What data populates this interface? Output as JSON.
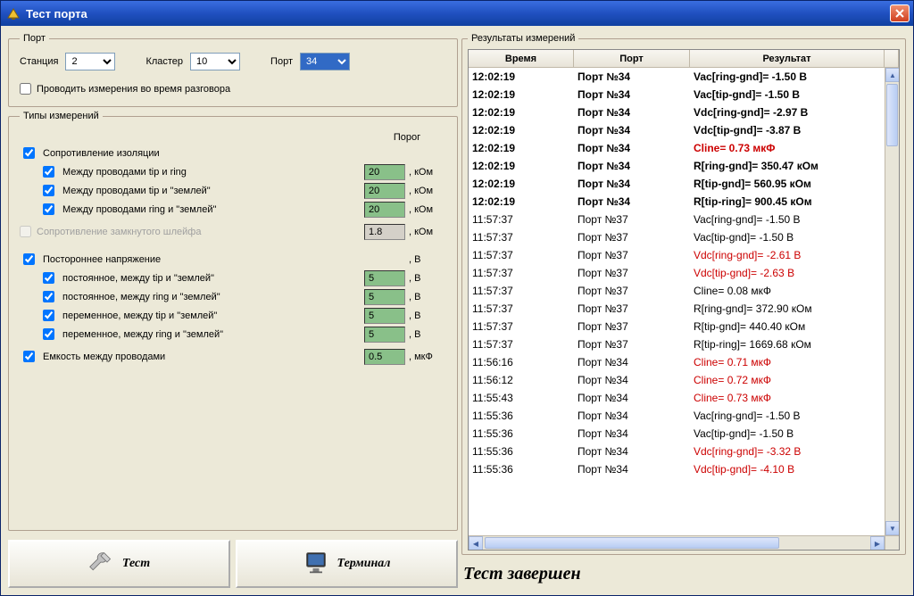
{
  "window": {
    "title": "Тест порта"
  },
  "port": {
    "legend": "Порт",
    "station_label": "Станция",
    "station_value": "2",
    "cluster_label": "Кластер",
    "cluster_value": "10",
    "port_label": "Порт",
    "port_value": "34",
    "measure_during_call": "Проводить измерения во время разговора"
  },
  "types": {
    "legend": "Типы измерений",
    "threshold_header": "Порог",
    "insulation": "Сопротивление изоляции",
    "tip_ring": "Между проводами tip и ring",
    "tip_gnd": "Между проводами tip и \"землей\"",
    "ring_gnd": "Между проводами ring и \"землей\"",
    "loop_res": "Сопротивление замкнутого шлейфа",
    "foreign_volt": "Постороннее напряжение",
    "dc_tip_gnd": "постоянное, между tip и \"землей\"",
    "dc_ring_gnd": "постоянное, между ring и \"землей\"",
    "ac_tip_gnd": "переменное, между tip и \"землей\"",
    "ac_ring_gnd": "переменное, между ring и \"землей\"",
    "capacitance": "Емкость между проводами",
    "v_tip_ring": "20",
    "v_tip_gnd": "20",
    "v_ring_gnd": "20",
    "v_loop": "1.8",
    "v_dc_tip": "5",
    "v_dc_ring": "5",
    "v_ac_tip": "5",
    "v_ac_ring": "5",
    "v_cap": "0.5",
    "u_kohm": ", кОм",
    "u_volt": ", В",
    "u_mkf": ", мкФ"
  },
  "buttons": {
    "test": "Тест",
    "terminal": "Терминал"
  },
  "results": {
    "legend": "Результаты измерений",
    "col_time": "Время",
    "col_port": "Порт",
    "col_result": "Результат",
    "rows": [
      {
        "time": "12:02:19",
        "port": "Порт №34",
        "res": "Vac[ring-gnd]=   -1.50 В",
        "bold": true,
        "red": false
      },
      {
        "time": "12:02:19",
        "port": "Порт №34",
        "res": "Vac[tip-gnd]=   -1.50 В",
        "bold": true,
        "red": false
      },
      {
        "time": "12:02:19",
        "port": "Порт №34",
        "res": "Vdc[ring-gnd]=   -2.97 В",
        "bold": true,
        "red": false
      },
      {
        "time": "12:02:19",
        "port": "Порт №34",
        "res": "Vdc[tip-gnd]=   -3.87 В",
        "bold": true,
        "red": false
      },
      {
        "time": "12:02:19",
        "port": "Порт №34",
        "res": "Cline=    0.73 мкФ",
        "bold": true,
        "red": true
      },
      {
        "time": "12:02:19",
        "port": "Порт №34",
        "res": "R[ring-gnd]=  350.47 кОм",
        "bold": true,
        "red": false
      },
      {
        "time": "12:02:19",
        "port": "Порт №34",
        "res": "R[tip-gnd]=  560.95 кОм",
        "bold": true,
        "red": false
      },
      {
        "time": "12:02:19",
        "port": "Порт №34",
        "res": "R[tip-ring]=   900.45 кОм",
        "bold": true,
        "red": false
      },
      {
        "time": "11:57:37",
        "port": "Порт №37",
        "res": "Vac[ring-gnd]=   -1.50 В",
        "bold": false,
        "red": false
      },
      {
        "time": "11:57:37",
        "port": "Порт №37",
        "res": "Vac[tip-gnd]=   -1.50 В",
        "bold": false,
        "red": false
      },
      {
        "time": "11:57:37",
        "port": "Порт №37",
        "res": "Vdc[ring-gnd]=   -2.61 В",
        "bold": false,
        "red": true
      },
      {
        "time": "11:57:37",
        "port": "Порт №37",
        "res": "Vdc[tip-gnd]=   -2.63 В",
        "bold": false,
        "red": true
      },
      {
        "time": "11:57:37",
        "port": "Порт №37",
        "res": "Cline=    0.08 мкФ",
        "bold": false,
        "red": false
      },
      {
        "time": "11:57:37",
        "port": "Порт №37",
        "res": "R[ring-gnd]=  372.90 кОм",
        "bold": false,
        "red": false
      },
      {
        "time": "11:57:37",
        "port": "Порт №37",
        "res": "R[tip-gnd]=  440.40 кОм",
        "bold": false,
        "red": false
      },
      {
        "time": "11:57:37",
        "port": "Порт №37",
        "res": "R[tip-ring]= 1669.68 кОм",
        "bold": false,
        "red": false
      },
      {
        "time": "11:56:16",
        "port": "Порт №34",
        "res": "Cline=    0.71 мкФ",
        "bold": false,
        "red": true
      },
      {
        "time": "11:56:12",
        "port": "Порт №34",
        "res": "Cline=    0.72 мкФ",
        "bold": false,
        "red": true
      },
      {
        "time": "11:55:43",
        "port": "Порт №34",
        "res": "Cline=    0.73 мкФ",
        "bold": false,
        "red": true
      },
      {
        "time": "11:55:36",
        "port": "Порт №34",
        "res": "Vac[ring-gnd]=   -1.50 В",
        "bold": false,
        "red": false
      },
      {
        "time": "11:55:36",
        "port": "Порт №34",
        "res": "Vac[tip-gnd]=   -1.50 В",
        "bold": false,
        "red": false
      },
      {
        "time": "11:55:36",
        "port": "Порт №34",
        "res": "Vdc[ring-gnd]=   -3.32 В",
        "bold": false,
        "red": true
      },
      {
        "time": "11:55:36",
        "port": "Порт №34",
        "res": "Vdc[tip-gnd]=   -4.10 В",
        "bold": false,
        "red": true
      }
    ]
  },
  "status": "Тест завершен"
}
